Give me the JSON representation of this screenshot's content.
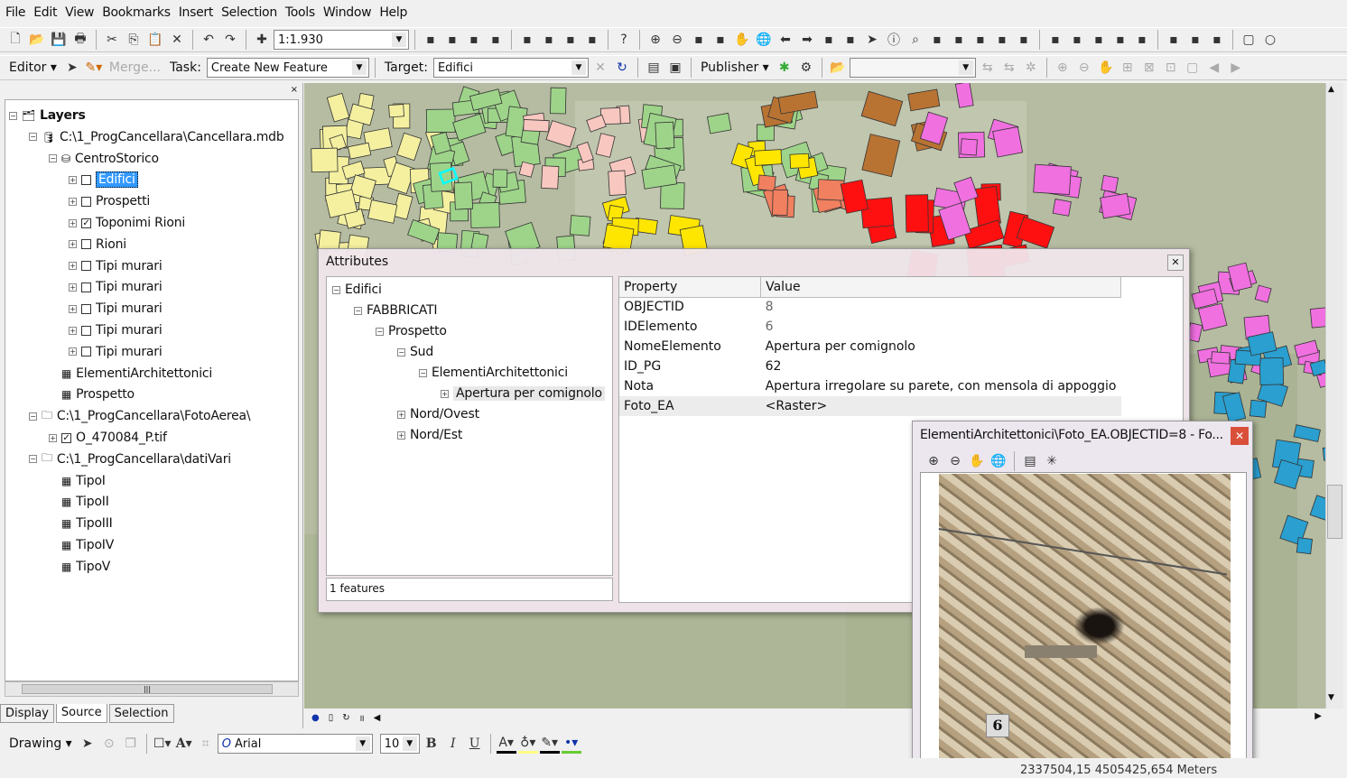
{
  "menu": [
    "File",
    "Edit",
    "View",
    "Bookmarks",
    "Insert",
    "Selection",
    "Tools",
    "Window",
    "Help"
  ],
  "toolbar1": {
    "scale": "1:1.930",
    "icons": [
      "new-icon",
      "open-icon",
      "save-icon",
      "print-icon",
      "|",
      "cut-icon",
      "copy-icon",
      "paste-icon",
      "delete-icon",
      "|",
      "undo-icon",
      "redo-icon",
      "|",
      "add-data-icon"
    ],
    "icons2": [
      "editor-sketch-icon",
      "layer-icon",
      "magic-wand-icon",
      "measure-icon",
      "|",
      "3d-icon",
      "toolbox-icon",
      "window-icon",
      "model-icon",
      "|",
      "whats-this-icon",
      "|",
      "zoom-in-icon",
      "zoom-out-icon",
      "fixed-zoom-in-icon",
      "fixed-zoom-out-icon",
      "pan-icon",
      "full-extent-icon",
      "back-icon",
      "forward-icon",
      "select-features-icon",
      "clear-selection-icon",
      "select-elements-icon",
      "identify-icon",
      "find-icon",
      "go-to-xy-icon",
      "measure-tool-icon",
      "hyperlink-icon",
      "html-popup-icon",
      "time-slider-icon",
      "|",
      "edit-vertices-icon",
      "reshape-icon",
      "split-icon",
      "cut-polygon-icon",
      "trace-icon",
      "|",
      "snap-icon",
      "topology-icon",
      "topology2-icon",
      "|",
      "rectangle-icon",
      "circle-icon"
    ]
  },
  "toolbar2": {
    "editor": "Editor",
    "merge": "Merge...",
    "task_label": "Task:",
    "task": "Create New Feature",
    "target_label": "Target:",
    "target": "Edifici",
    "publisher": "Publisher"
  },
  "toc": {
    "items": [
      {
        "level": 0,
        "label": "Layers",
        "pm": "-",
        "icon": "layers-icon",
        "bold": true
      },
      {
        "level": 1,
        "label": "C:\\1_ProgCancellara\\Cancellara.mdb",
        "pm": "-",
        "icon": "database-icon"
      },
      {
        "level": 2,
        "label": "CentroStorico",
        "pm": "-",
        "icon": "feature-dataset-icon"
      },
      {
        "level": 3,
        "label": "Edifici",
        "pm": "+",
        "check": false,
        "selected": true
      },
      {
        "level": 3,
        "label": "Prospetti",
        "pm": "+",
        "check": false
      },
      {
        "level": 3,
        "label": "Toponimi Rioni",
        "pm": "+",
        "check": true
      },
      {
        "level": 3,
        "label": "Rioni",
        "pm": "+",
        "check": false
      },
      {
        "level": 3,
        "label": "Tipi murari",
        "pm": "+",
        "check": false
      },
      {
        "level": 3,
        "label": "Tipi murari",
        "pm": "+",
        "check": false
      },
      {
        "level": 3,
        "label": "Tipi murari",
        "pm": "+",
        "check": false
      },
      {
        "level": 3,
        "label": "Tipi murari",
        "pm": "+",
        "check": false
      },
      {
        "level": 3,
        "label": "Tipi murari",
        "pm": "+",
        "check": false
      },
      {
        "level": 2,
        "label": "ElementiArchitettonici",
        "icon": "table-icon"
      },
      {
        "level": 2,
        "label": "Prospetto",
        "icon": "table-icon"
      },
      {
        "level": 1,
        "label": "C:\\1_ProgCancellara\\FotoAerea\\",
        "pm": "-",
        "icon": "folder-icon"
      },
      {
        "level": 2,
        "label": "O_470084_P.tif",
        "pm": "+",
        "check": true,
        "noicon": true
      },
      {
        "level": 1,
        "label": "C:\\1_ProgCancellara\\datiVari",
        "pm": "-",
        "icon": "folder-icon"
      },
      {
        "level": 2,
        "label": "TipoI",
        "icon": "table-icon"
      },
      {
        "level": 2,
        "label": "TipoII",
        "icon": "table-icon"
      },
      {
        "level": 2,
        "label": "TipoIII",
        "icon": "table-icon"
      },
      {
        "level": 2,
        "label": "TipoIV",
        "icon": "table-icon"
      },
      {
        "level": 2,
        "label": "TipoV",
        "icon": "table-icon"
      }
    ],
    "tabs": [
      "Display",
      "Source",
      "Selection"
    ],
    "active_tab": "Source"
  },
  "attributes": {
    "title": "Attributes",
    "tree": [
      {
        "level": 0,
        "label": "Edifici",
        "pm": "-"
      },
      {
        "level": 1,
        "label": "FABBRICATI",
        "pm": "-"
      },
      {
        "level": 2,
        "label": "Prospetto",
        "pm": "-"
      },
      {
        "level": 3,
        "label": "Sud",
        "pm": "-"
      },
      {
        "level": 4,
        "label": "ElementiArchitettonici",
        "pm": "-"
      },
      {
        "level": 5,
        "label": "Apertura per comignolo",
        "pm": "+",
        "selected": true
      },
      {
        "level": 3,
        "label": "Nord/Ovest",
        "pm": "+"
      },
      {
        "level": 3,
        "label": "Nord/Est",
        "pm": "+"
      }
    ],
    "features": "1 features",
    "columns": [
      "Property",
      "Value"
    ],
    "rows": [
      [
        "OBJECTID",
        "8"
      ],
      [
        "IDElemento",
        "6"
      ],
      [
        "NomeElemento",
        "Apertura per comignolo"
      ],
      [
        "ID_PG",
        "62"
      ],
      [
        "Nota",
        "Apertura irregolare su parete, con mensola di appoggio"
      ],
      [
        "Foto_EA",
        "<Raster>"
      ]
    ]
  },
  "photo": {
    "title": "ElementiArchitettonici\\Foto_EA.OBJECTID=8 - Fo...",
    "icons": [
      "zoom-in-icon",
      "zoom-out-icon",
      "pan-icon",
      "full-extent-icon",
      "|",
      "properties-icon",
      "flash-icon"
    ],
    "plate": "6"
  },
  "drawing": {
    "label": "Drawing",
    "font": "Arial",
    "size": "10"
  },
  "status": {
    "coords": "2337504,15  4505425,654 Meters"
  },
  "colors": {
    "yellow_light": "#f5f0a0",
    "green": "#9ed48a",
    "yellow": "#ffe600",
    "orange": "#f08060",
    "red": "#ff1010",
    "brown": "#b87333",
    "magenta": "#f070e0",
    "blue": "#2a9fd0",
    "pink": "#f8c8c0"
  }
}
